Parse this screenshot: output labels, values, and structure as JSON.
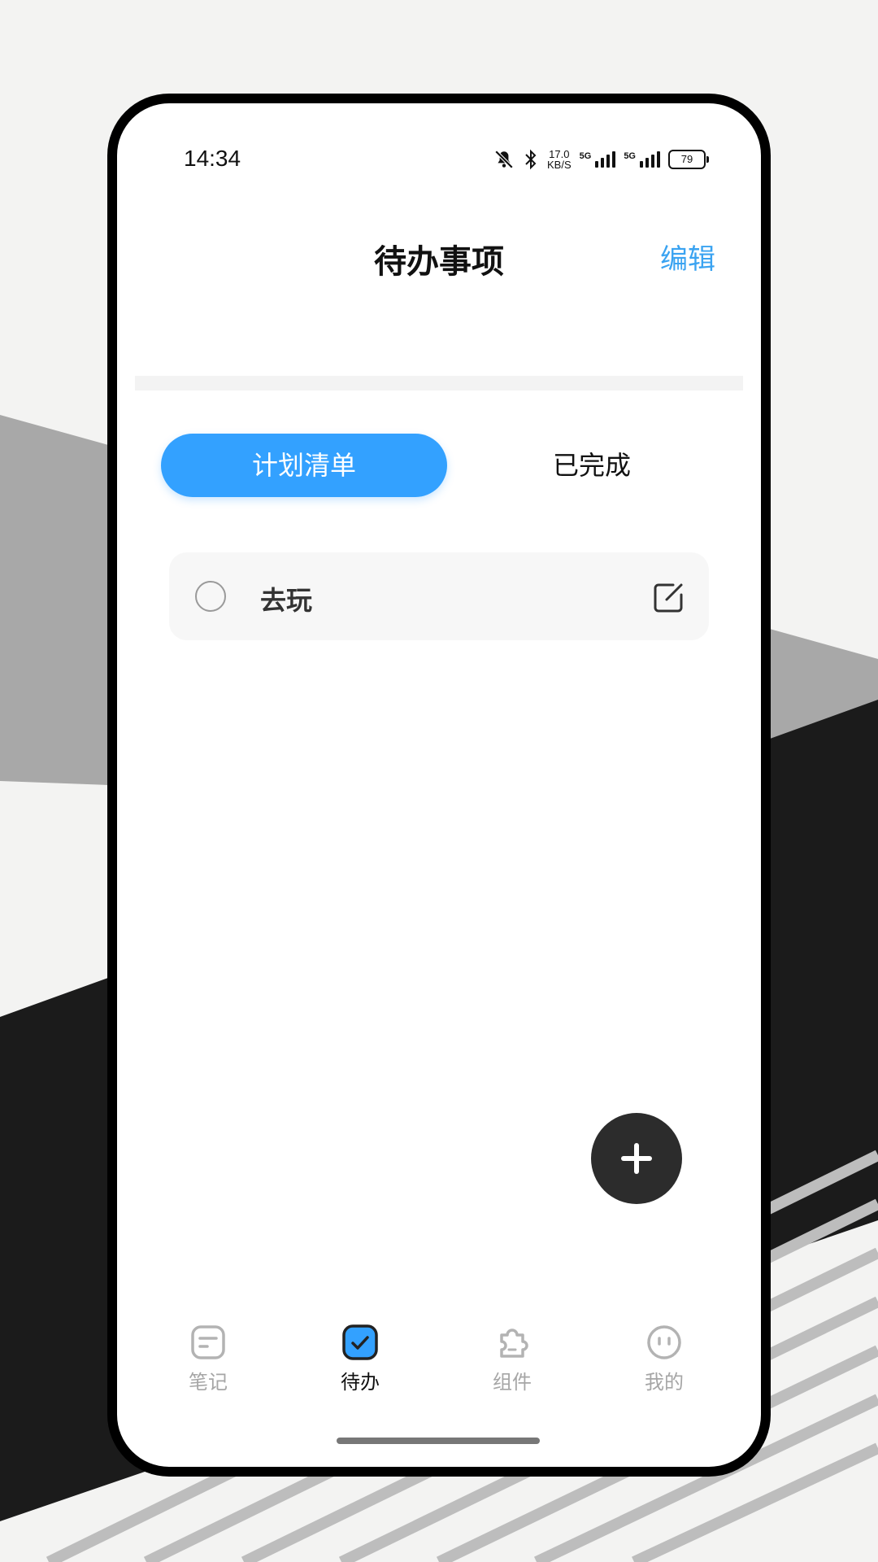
{
  "status_bar": {
    "time": "14:34",
    "net_speed_value": "17.0",
    "net_speed_unit": "KB/S",
    "sim1_label": "5G",
    "sim2_label": "5G",
    "battery": "79"
  },
  "header": {
    "title": "待办事项",
    "edit_label": "编辑"
  },
  "tabs": {
    "plan_list": "计划清单",
    "completed": "已完成"
  },
  "todos": [
    {
      "text": "去玩",
      "checked": false
    }
  ],
  "bottom_nav": {
    "notes": "笔记",
    "todo": "待办",
    "widgets": "组件",
    "mine": "我的"
  },
  "colors": {
    "accent": "#33a1ff",
    "edit_text": "#3aa3f1",
    "fab": "#2c2c2c"
  }
}
